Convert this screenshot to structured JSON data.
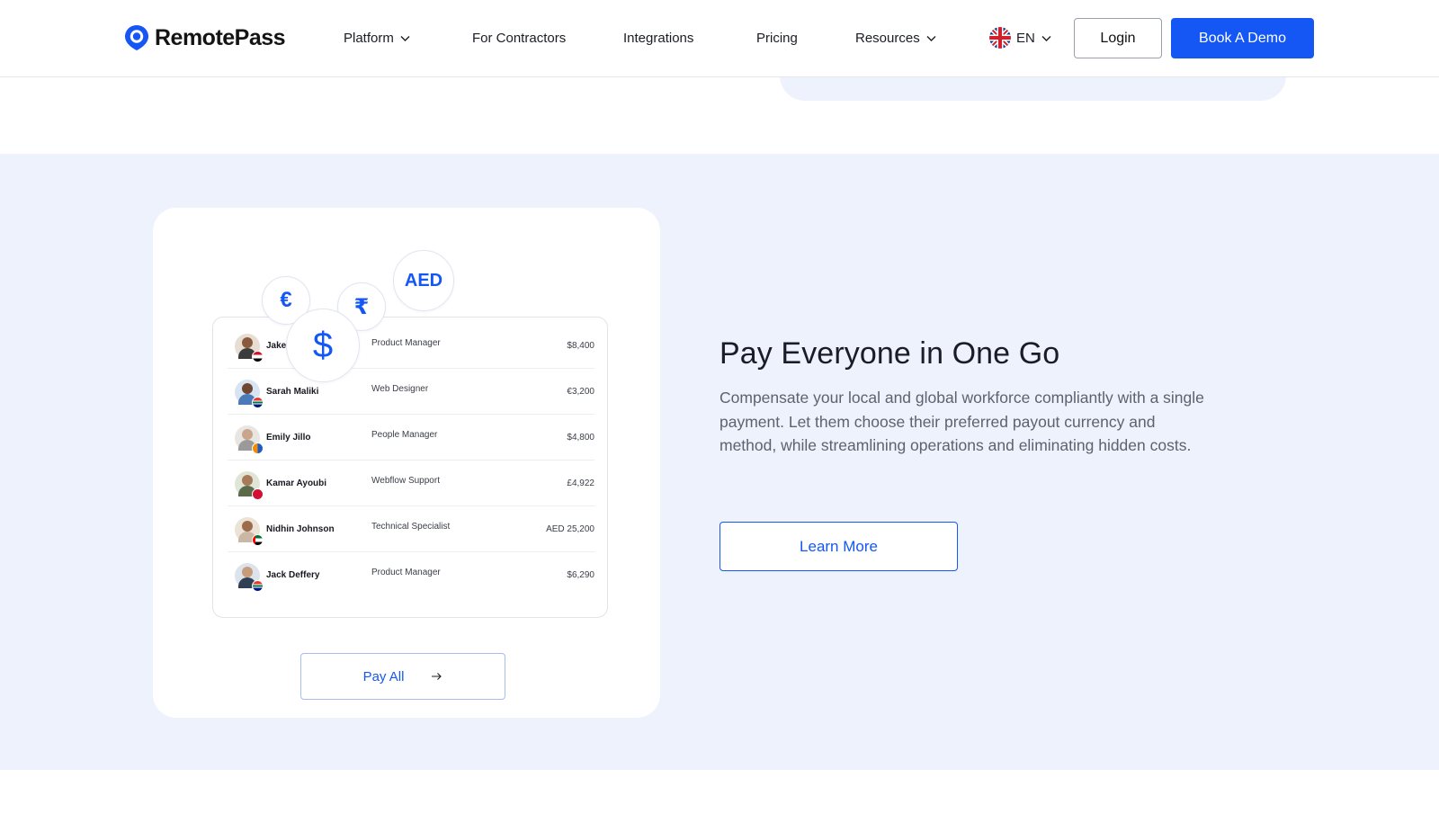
{
  "brand": {
    "name": "RemotePass",
    "color": "#1457f5"
  },
  "nav": {
    "items": [
      {
        "label": "Platform",
        "dropdown": true
      },
      {
        "label": "For Contractors",
        "dropdown": false
      },
      {
        "label": "Integrations",
        "dropdown": false
      },
      {
        "label": "Pricing",
        "dropdown": false
      },
      {
        "label": "Resources",
        "dropdown": true
      }
    ],
    "language": "EN",
    "login_label": "Login",
    "demo_label": "Book A Demo"
  },
  "feature": {
    "title": "Pay Everyone in One Go",
    "description": "Compensate your local and global workforce compliantly with a single payment. Let them choose their preferred payout currency and method, while streamlining operations and eliminating hidden costs.",
    "cta_label": "Learn More"
  },
  "illustration": {
    "currencies": [
      "€",
      "₹",
      "AED",
      "$"
    ],
    "pay_all_label": "Pay All",
    "rows": [
      {
        "name": "Jake",
        "role": "Product Manager",
        "amount": "$8,400",
        "flag": "egypt"
      },
      {
        "name": "Sarah Maliki",
        "role": "Web Designer",
        "amount": "€3,200",
        "flag": "south-africa"
      },
      {
        "name": "Emily Jillo",
        "role": "People Manager",
        "amount": "$4,800",
        "flag": "generic"
      },
      {
        "name": "Kamar Ayoubi",
        "role": "Webflow Support",
        "amount": "£4,922",
        "flag": "red"
      },
      {
        "name": "Nidhin Johnson",
        "role": "Technical Specialist",
        "amount": "AED 25,200",
        "flag": "uae"
      },
      {
        "name": "Jack Deffery",
        "role": "Product Manager",
        "amount": "$6,290",
        "flag": "south-africa"
      }
    ]
  }
}
